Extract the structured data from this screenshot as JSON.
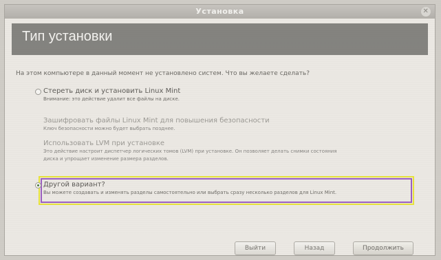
{
  "window": {
    "title": "Установка"
  },
  "header": {
    "title": "Тип установки"
  },
  "question": "На этом компьютере в данный момент не установлено систем. Что вы желаете сделать?",
  "options": [
    {
      "title": "Стереть диск и установить Linux Mint",
      "desc": "Внимание: это действие удалит все файлы на диске.",
      "checked": false,
      "disabled": false
    },
    {
      "title": "Зашифровать файлы Linux Mint для повышения безопасности",
      "desc": "Ключ безопасности можно будет выбрать позднее.",
      "checked": false,
      "disabled": true
    },
    {
      "title": "Использовать LVM при установке",
      "desc": "Это действие настроит диспетчер логических томов (LVM) при установке. Он позволяет делать снимки состояния",
      "desc2": "диска и упрощает изменение размера разделов.",
      "checked": false,
      "disabled": true
    },
    {
      "title": "Другой вариант?",
      "desc": "Вы можете создавать и изменять разделы самостоятельно или выбрать сразу несколько разделов для Linux Mint.",
      "checked": true,
      "disabled": false
    }
  ],
  "buttons": {
    "quit": "Выйти",
    "back": "Назад",
    "continue": "Продолжить"
  },
  "colors": {
    "header_bg": "#84837f",
    "highlight_outer": "#e8e23a",
    "highlight_inner": "#9b5fc0"
  }
}
